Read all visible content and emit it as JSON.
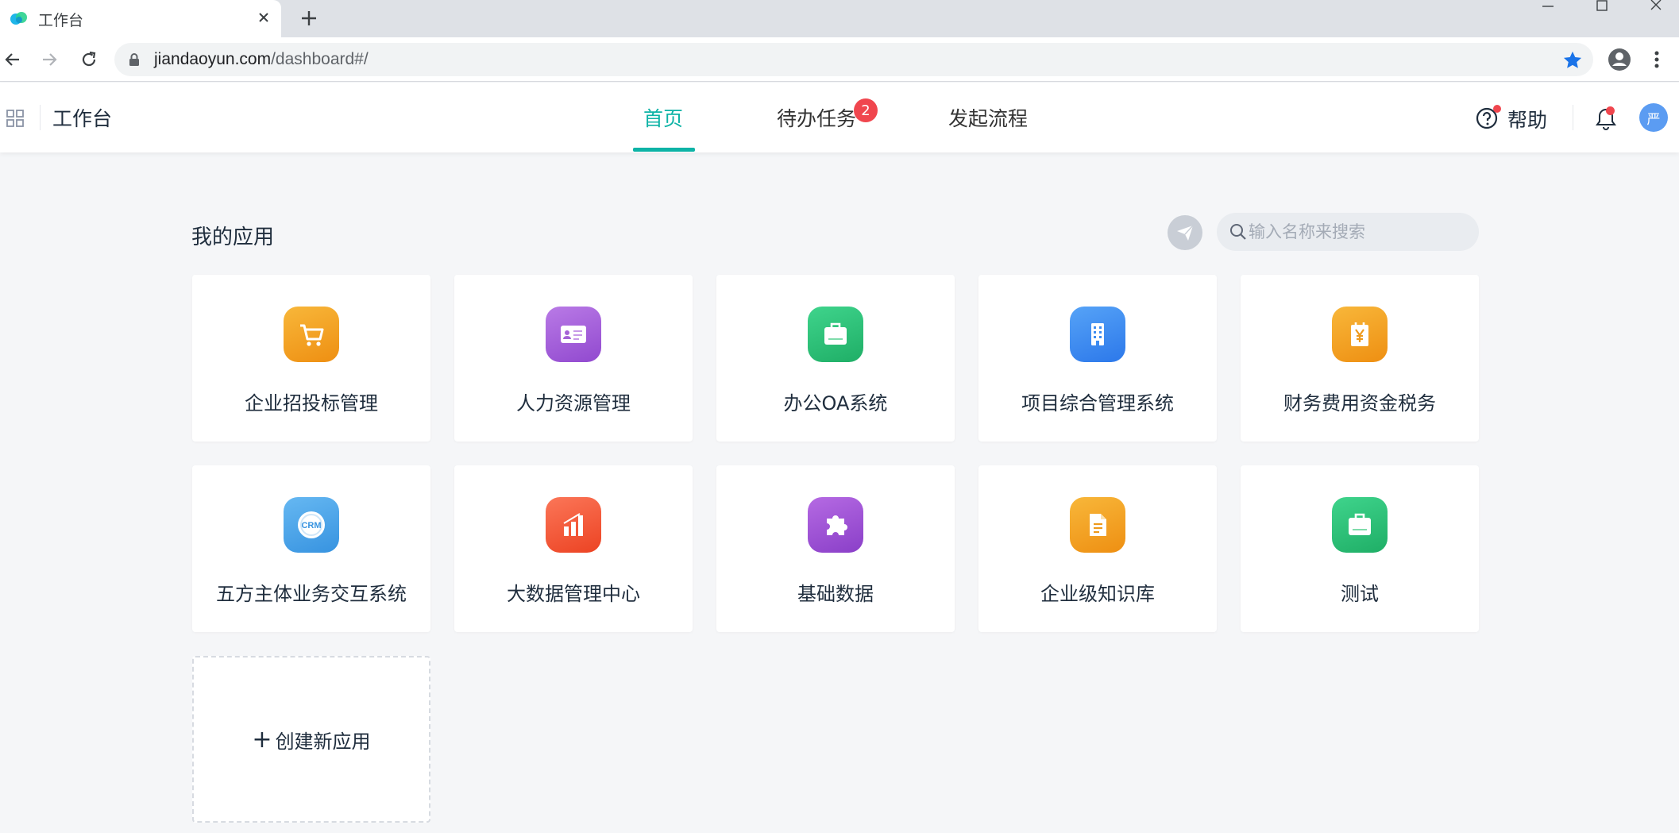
{
  "browser": {
    "tab_title": "工作台",
    "url_host": "jiandaoyun.com",
    "url_path": "/dashboard#/"
  },
  "header": {
    "app_title": "工作台",
    "nav": [
      {
        "label": "首页",
        "active": true
      },
      {
        "label": "待办任务",
        "badge": "2"
      },
      {
        "label": "发起流程"
      }
    ],
    "help_label": "帮助",
    "avatar_text": "严"
  },
  "main": {
    "section_title": "我的应用",
    "search_placeholder": "输入名称来搜索",
    "apps": [
      {
        "label": "企业招投标管理",
        "icon": "cart-icon",
        "color": "#f4a21f"
      },
      {
        "label": "人力资源管理",
        "icon": "id-card-icon",
        "color": "#a564d6"
      },
      {
        "label": "办公OA系统",
        "icon": "briefcase-icon",
        "color": "#2fc27b"
      },
      {
        "label": "项目综合管理系统",
        "icon": "building-icon",
        "color": "#3d8cf2"
      },
      {
        "label": "财务费用资金税务",
        "icon": "yen-document-icon",
        "color": "#f4a21f"
      },
      {
        "label": "五方主体业务交互系统",
        "icon": "crm-icon",
        "color": "#4aa3e8"
      },
      {
        "label": "大数据管理中心",
        "icon": "bar-chart-icon",
        "color": "#f35c3b"
      },
      {
        "label": "基础数据",
        "icon": "puzzle-icon",
        "color": "#a355d6"
      },
      {
        "label": "企业级知识库",
        "icon": "document-icon",
        "color": "#f2a426"
      },
      {
        "label": "测试",
        "icon": "briefcase-icon",
        "color": "#2fc27b"
      }
    ],
    "create_label": "创建新应用",
    "create_plus": "+"
  }
}
